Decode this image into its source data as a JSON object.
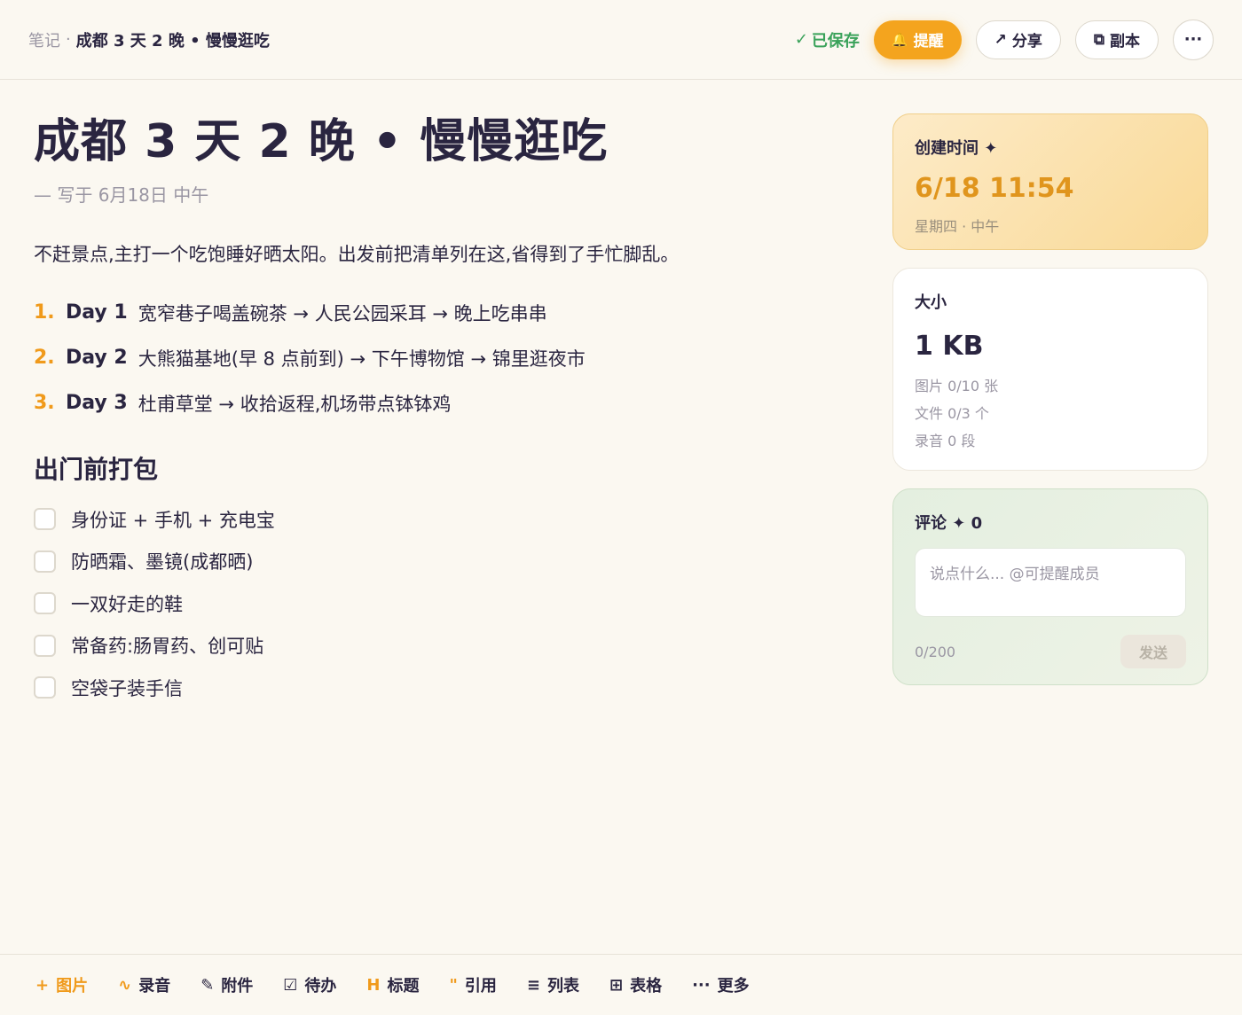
{
  "header": {
    "crumb_root": "笔记",
    "crumb_sep": "·",
    "crumb_current": "成都 3 天 2 晚 • 慢慢逛吃",
    "saved_icon": "✓",
    "saved_label": "已保存",
    "remind_label": "提醒",
    "remind_icon": "🔔",
    "share_icon": "↗",
    "share_label": "分享",
    "copy_icon": "⧉",
    "copy_label": "副本",
    "more_icon": "···"
  },
  "note": {
    "title": "成都 3 天 2 晚 • 慢慢逛吃",
    "subtitle": "— 写于 6月18日 中午",
    "intro": "不赶景点,主打一个吃饱睡好晒太阳。出发前把清单列在这,省得到了手忙脚乱。",
    "plan": [
      {
        "num": "1.",
        "day": "Day 1",
        "desc": "宽窄巷子喝盖碗茶 → 人民公园采耳 → 晚上吃串串"
      },
      {
        "num": "2.",
        "day": "Day 2",
        "desc": "大熊猫基地(早 8 点前到) → 下午博物馆 → 锦里逛夜市"
      },
      {
        "num": "3.",
        "day": "Day 3",
        "desc": "杜甫草堂 → 收拾返程,机场带点钵钵鸡"
      }
    ],
    "section_title": "出门前打包",
    "todos": [
      {
        "label": "身份证 + 手机 + 充电宝",
        "checked": false
      },
      {
        "label": "防晒霜、墨镜(成都晒)",
        "checked": false
      },
      {
        "label": "一双好走的鞋",
        "checked": false
      },
      {
        "label": "常备药:肠胃药、创可贴",
        "checked": false
      },
      {
        "label": "空袋子装手信",
        "checked": false
      }
    ]
  },
  "sidebar": {
    "created": {
      "heading": "创建时间 ✦",
      "time": "6/18 11:54",
      "sub": "星期四 · 中午"
    },
    "size": {
      "heading": "大小",
      "value": "1 KB",
      "images": "图片 0/10 张",
      "files": "文件 0/3 个",
      "audio": "录音 0 段"
    },
    "comments": {
      "heading": "评论 ✦ 0",
      "placeholder": "说点什么... @可提醒成员",
      "counter": "0/200",
      "send_label": "发送"
    }
  },
  "toolbar": {
    "items": [
      {
        "icon": "+",
        "label": "图片"
      },
      {
        "icon": "∿",
        "label": "录音"
      },
      {
        "icon": "✎",
        "label": "附件"
      },
      {
        "icon": "☑",
        "label": "待办"
      },
      {
        "icon": "H",
        "label": "标题"
      },
      {
        "icon": "\"",
        "label": "引用"
      },
      {
        "icon": "≡",
        "label": "列表"
      },
      {
        "icon": "⊞",
        "label": "表格"
      },
      {
        "icon": "···",
        "label": "更多"
      }
    ]
  },
  "colors": {
    "accent": "#f4a41e",
    "saved": "#3aa25a",
    "background": "#fbf8f1"
  }
}
